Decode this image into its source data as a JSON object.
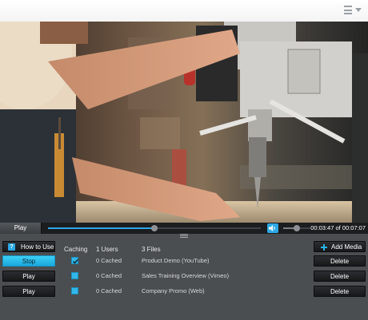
{
  "topbar": {
    "menu_icon": "hamburger-menu-icon"
  },
  "player": {
    "play_label": "Play",
    "progress": 0.5,
    "volume": 0.5,
    "time_display": "00:03:47 of 00:07:07",
    "volume_icon": "speaker-icon"
  },
  "toolbar": {
    "how_to_use_label": "How to Use",
    "caching_header": "Caching",
    "users_header": "1 Users",
    "files_header": "3 Files",
    "add_media_label": "Add Media"
  },
  "rows": [
    {
      "action_label": "Stop",
      "active": true,
      "cached": true,
      "cache_status": "0 Cached",
      "file_name": "Product Demo (YouTube)",
      "delete_label": "Delete"
    },
    {
      "action_label": "Play",
      "active": false,
      "cached": false,
      "cache_status": "0 Cached",
      "file_name": "Sales Training Overview (Vimeo)",
      "delete_label": "Delete"
    },
    {
      "action_label": "Play",
      "active": false,
      "cached": false,
      "cache_status": "0 Cached",
      "file_name": "Company Promo (Web)",
      "delete_label": "Delete"
    }
  ],
  "colors": {
    "accent": "#2ea7e6",
    "panel": "#4b4e51",
    "control_bar": "#1b1d1f"
  }
}
